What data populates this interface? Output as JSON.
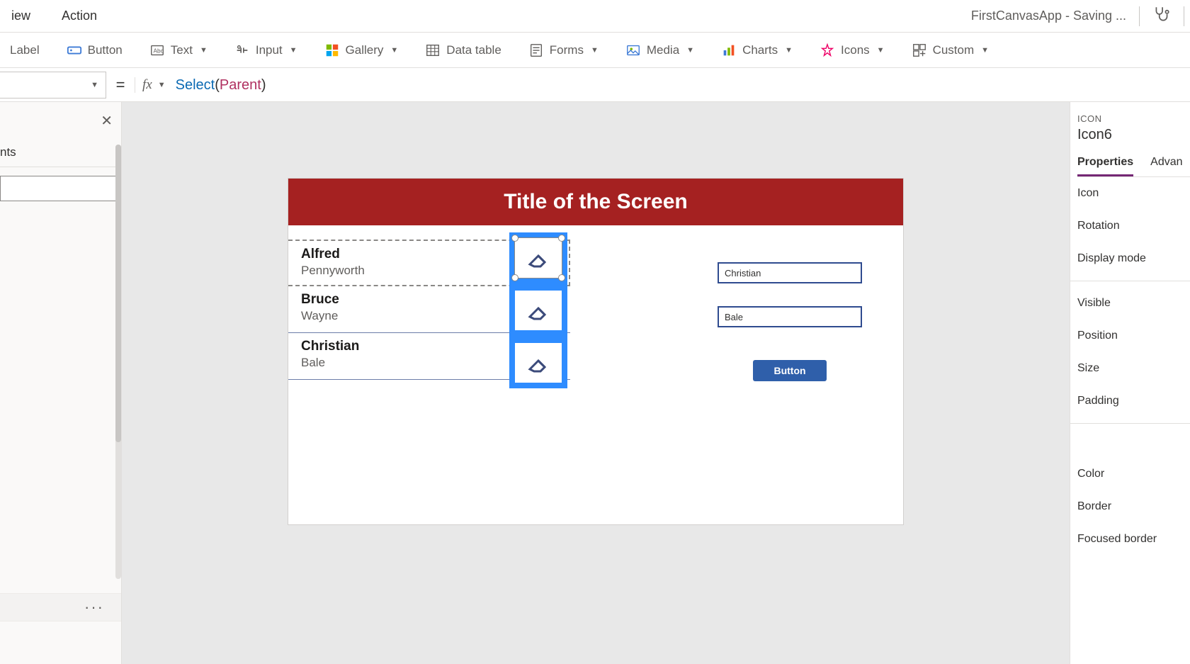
{
  "menubar": {
    "items": [
      "iew",
      "Action"
    ],
    "app_title": "FirstCanvasApp - Saving ..."
  },
  "ribbon": {
    "label_btn": "Label",
    "button_btn": "Button",
    "text_btn": "Text",
    "input_btn": "Input",
    "gallery_btn": "Gallery",
    "datatable_btn": "Data table",
    "forms_btn": "Forms",
    "media_btn": "Media",
    "charts_btn": "Charts",
    "icons_btn": "Icons",
    "custom_btn": "Custom"
  },
  "formula": {
    "fx": "fx",
    "fn": "Select",
    "open": "(",
    "arg": "Parent",
    "close": ")"
  },
  "left": {
    "tab_label": "nts",
    "more": "···"
  },
  "canvas": {
    "title": "Title of the Screen",
    "gallery": [
      {
        "first": "Alfred",
        "last": "Pennyworth"
      },
      {
        "first": "Bruce",
        "last": "Wayne"
      },
      {
        "first": "Christian",
        "last": "Bale"
      }
    ],
    "input1": "Christian",
    "input2": "Bale",
    "button": "Button"
  },
  "props": {
    "type": "ICON",
    "name": "Icon6",
    "tabs": {
      "properties": "Properties",
      "advanced": "Advan"
    },
    "rows": {
      "icon": "Icon",
      "rotation": "Rotation",
      "display_mode": "Display mode",
      "visible": "Visible",
      "position": "Position",
      "size": "Size",
      "padding": "Padding",
      "color": "Color",
      "border": "Border",
      "focused_border": "Focused border"
    }
  }
}
